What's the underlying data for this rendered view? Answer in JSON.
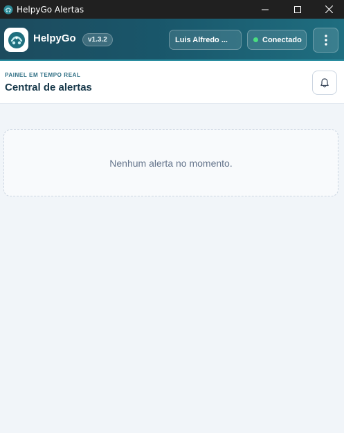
{
  "window": {
    "title": "HelpyGo Alertas",
    "controls": [
      "minimize-icon",
      "maximize-icon",
      "close-icon"
    ]
  },
  "appbar": {
    "brand": "HelpyGo",
    "version": "v1.3.2",
    "user": "Luis Alfredo ...",
    "status": "Conectado",
    "menu_icon": "kebab-menu-icon"
  },
  "panel": {
    "eyebrow": "PAINEL EM TEMPO REAL",
    "title": "Central de alertas",
    "bell_icon": "bell-icon"
  },
  "alerts": {
    "items": [],
    "empty_message": "Nenhum alerta no momento."
  },
  "colors": {
    "brand": "#1d5a6e",
    "accent": "#2a8da0",
    "status_online": "#4ade80"
  }
}
